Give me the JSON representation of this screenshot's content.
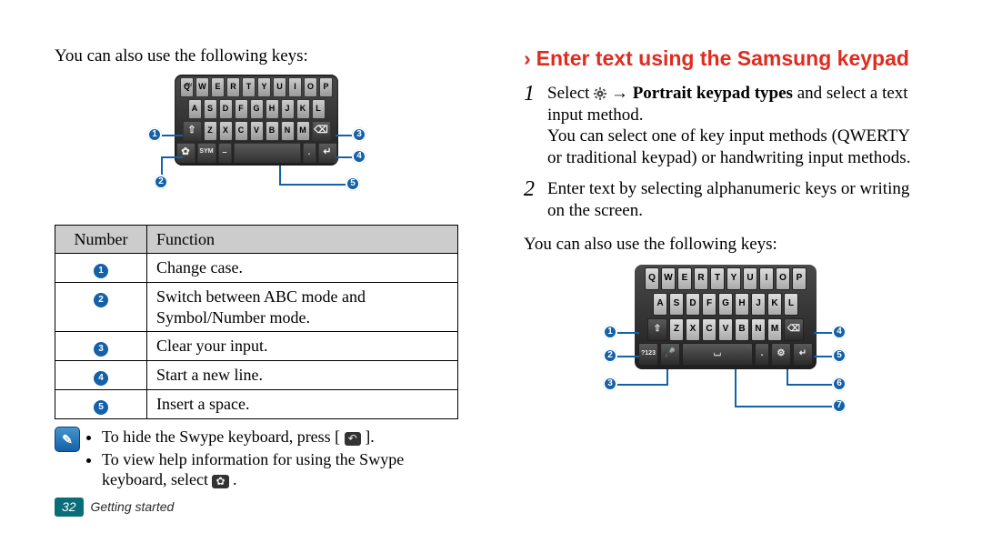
{
  "left": {
    "intro": "You can also use the following keys:",
    "keyboard1": {
      "rows": [
        [
          "Q",
          "W",
          "E",
          "R",
          "T",
          "Y",
          "U",
          "I",
          "O",
          "P"
        ],
        [
          "A",
          "S",
          "D",
          "F",
          "G",
          "H",
          "J",
          "K",
          "L"
        ],
        [
          "⇧",
          "Z",
          "X",
          "C",
          "V",
          "B",
          "N",
          "M",
          "⌫"
        ],
        [
          "✿",
          "SYM",
          "–",
          "␣",
          ".",
          "↵"
        ]
      ],
      "callouts": [
        1,
        2,
        3,
        4,
        5
      ]
    },
    "table": {
      "head_number": "Number",
      "head_function": "Function",
      "rows": [
        {
          "n": 1,
          "f": "Change case."
        },
        {
          "n": 2,
          "f": "Switch between ABC mode and Symbol/Number mode."
        },
        {
          "n": 3,
          "f": "Clear your input."
        },
        {
          "n": 4,
          "f": "Start a new line."
        },
        {
          "n": 5,
          "f": "Insert a space."
        }
      ]
    },
    "tip1": "To hide the Swype keyboard, press [",
    "tip1_icon": "↶",
    "tip1_end": "].",
    "tip2a": "To view help information for using the Swype keyboard, select ",
    "tip2_icon": "✿",
    "tip2b": "."
  },
  "right": {
    "heading": "Enter text using the Samsung keypad",
    "step1a": "Select ",
    "gear_name": "settings-gear-icon",
    "step1b": " → ",
    "step1c": "Portrait keypad types",
    "step1d": " and select a text input method.",
    "step1e": "You can select one of key input methods (QWERTY or traditional keypad) or handwriting input methods.",
    "step2": "Enter text by selecting alphanumeric keys or writing on the screen.",
    "also": "You can also use the following keys:",
    "keyboard2": {
      "rows": [
        [
          "Q",
          "W",
          "E",
          "R",
          "T",
          "Y",
          "U",
          "I",
          "O",
          "P"
        ],
        [
          "A",
          "S",
          "D",
          "F",
          "G",
          "H",
          "J",
          "K",
          "L"
        ],
        [
          "⇧",
          "Z",
          "X",
          "C",
          "V",
          "B",
          "N",
          "M",
          "⌫"
        ],
        [
          "?123",
          "🎤",
          "␣",
          ".",
          "⚙",
          "↵"
        ]
      ],
      "callouts": [
        1,
        2,
        3,
        4,
        5,
        6,
        7
      ]
    }
  },
  "footer": {
    "page": "32",
    "section": "Getting started"
  }
}
